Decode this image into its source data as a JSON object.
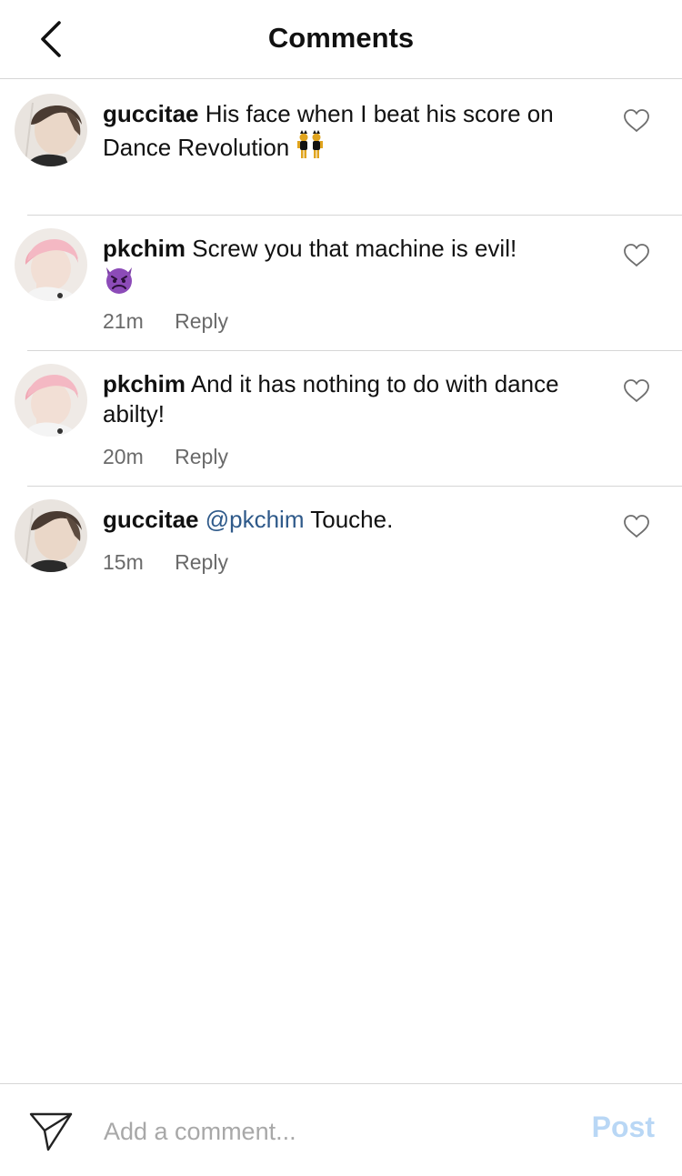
{
  "header": {
    "title": "Comments",
    "back_icon": "chevron-left-icon"
  },
  "comments": [
    {
      "username": "guccitae",
      "text": "His face when I beat his score on Dance Revolution",
      "emoji": "👯",
      "time": "",
      "reply_label": "",
      "avatar": "guccitae-avatar"
    },
    {
      "username": "pkchim",
      "text": "Screw you that machine is evil!",
      "emoji": "👿",
      "time": "21m",
      "reply_label": "Reply",
      "avatar": "pkchim-avatar"
    },
    {
      "username": "pkchim",
      "text": "And it has nothing to do with dance abilty!",
      "time": "20m",
      "reply_label": "Reply",
      "avatar": "pkchim-avatar"
    },
    {
      "username": "guccitae",
      "mention": "@pkchim",
      "text": "Touche.",
      "time": "15m",
      "reply_label": "Reply",
      "avatar": "guccitae-avatar"
    }
  ],
  "footer": {
    "placeholder": "Add a comment...",
    "post_label": "Post",
    "send_icon": "paper-plane-icon"
  },
  "colors": {
    "mention": "#2f5a8a",
    "post_disabled": "#b9d7f5",
    "meta_text": "#6a6a6a",
    "divider": "#d6d6d6"
  }
}
